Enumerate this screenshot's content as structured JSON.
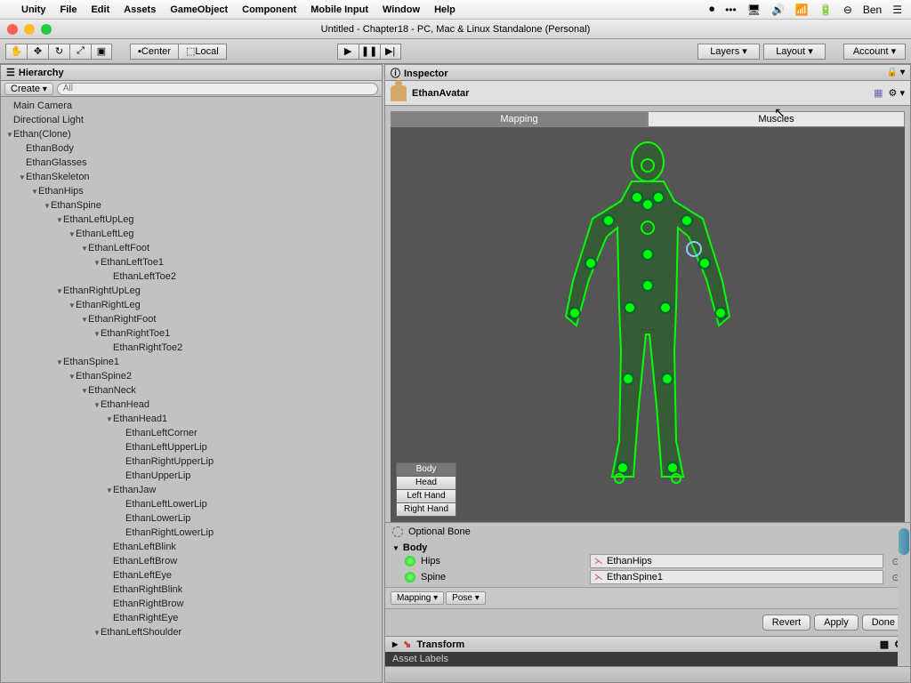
{
  "menubar": {
    "items": [
      "Unity",
      "File",
      "Edit",
      "Assets",
      "GameObject",
      "Component",
      "Mobile Input",
      "Window",
      "Help"
    ],
    "user": "Ben"
  },
  "window_title": "Untitled - Chapter18 - PC, Mac & Linux Standalone (Personal)",
  "toolbar": {
    "center": "Center",
    "local": "Local",
    "layers": "Layers",
    "layout": "Layout",
    "account": "Account"
  },
  "hierarchy": {
    "tab": "Hierarchy",
    "create": "Create",
    "search_placeholder": "All",
    "nodes": [
      {
        "d": 0,
        "a": false,
        "t": "Main Camera"
      },
      {
        "d": 0,
        "a": false,
        "t": "Directional Light"
      },
      {
        "d": 0,
        "a": true,
        "t": "Ethan(Clone)"
      },
      {
        "d": 1,
        "a": false,
        "t": "EthanBody"
      },
      {
        "d": 1,
        "a": false,
        "t": "EthanGlasses"
      },
      {
        "d": 1,
        "a": true,
        "t": "EthanSkeleton"
      },
      {
        "d": 2,
        "a": true,
        "t": "EthanHips"
      },
      {
        "d": 3,
        "a": true,
        "t": "EthanSpine"
      },
      {
        "d": 4,
        "a": true,
        "t": "EthanLeftUpLeg"
      },
      {
        "d": 5,
        "a": true,
        "t": "EthanLeftLeg"
      },
      {
        "d": 6,
        "a": true,
        "t": "EthanLeftFoot"
      },
      {
        "d": 7,
        "a": true,
        "t": "EthanLeftToe1"
      },
      {
        "d": 8,
        "a": false,
        "t": "EthanLeftToe2"
      },
      {
        "d": 4,
        "a": true,
        "t": "EthanRightUpLeg"
      },
      {
        "d": 5,
        "a": true,
        "t": "EthanRightLeg"
      },
      {
        "d": 6,
        "a": true,
        "t": "EthanRightFoot"
      },
      {
        "d": 7,
        "a": true,
        "t": "EthanRightToe1"
      },
      {
        "d": 8,
        "a": false,
        "t": "EthanRightToe2"
      },
      {
        "d": 4,
        "a": true,
        "t": "EthanSpine1"
      },
      {
        "d": 5,
        "a": true,
        "t": "EthanSpine2"
      },
      {
        "d": 6,
        "a": true,
        "t": "EthanNeck"
      },
      {
        "d": 7,
        "a": true,
        "t": "EthanHead"
      },
      {
        "d": 8,
        "a": true,
        "t": "EthanHead1"
      },
      {
        "d": 9,
        "a": false,
        "t": "EthanLeftCorner"
      },
      {
        "d": 9,
        "a": false,
        "t": "EthanLeftUpperLip"
      },
      {
        "d": 9,
        "a": false,
        "t": "EthanRightUpperLip"
      },
      {
        "d": 9,
        "a": false,
        "t": "EthanUpperLip"
      },
      {
        "d": 8,
        "a": true,
        "t": "EthanJaw"
      },
      {
        "d": 9,
        "a": false,
        "t": "EthanLeftLowerLip"
      },
      {
        "d": 9,
        "a": false,
        "t": "EthanLowerLip"
      },
      {
        "d": 9,
        "a": false,
        "t": "EthanRightLowerLip"
      },
      {
        "d": 8,
        "a": false,
        "t": "EthanLeftBlink"
      },
      {
        "d": 8,
        "a": false,
        "t": "EthanLeftBrow"
      },
      {
        "d": 8,
        "a": false,
        "t": "EthanLeftEye"
      },
      {
        "d": 8,
        "a": false,
        "t": "EthanRightBlink"
      },
      {
        "d": 8,
        "a": false,
        "t": "EthanRightBrow"
      },
      {
        "d": 8,
        "a": false,
        "t": "EthanRightEye"
      },
      {
        "d": 7,
        "a": true,
        "t": "EthanLeftShoulder"
      }
    ]
  },
  "inspector": {
    "tab": "Inspector",
    "avatar_name": "EthanAvatar",
    "tabs": {
      "mapping": "Mapping",
      "muscles": "Muscles"
    },
    "view_btns": [
      "Body",
      "Head",
      "Left Hand",
      "Right Hand"
    ],
    "optional": "Optional Bone",
    "body_header": "Body",
    "bones": [
      {
        "label": "Hips",
        "value": "EthanHips"
      },
      {
        "label": "Spine",
        "value": "EthanSpine1"
      }
    ],
    "dropdowns": [
      "Mapping",
      "Pose"
    ],
    "actions": [
      "Revert",
      "Apply",
      "Done"
    ],
    "transform": "Transform",
    "asset_labels": "Asset Labels"
  }
}
